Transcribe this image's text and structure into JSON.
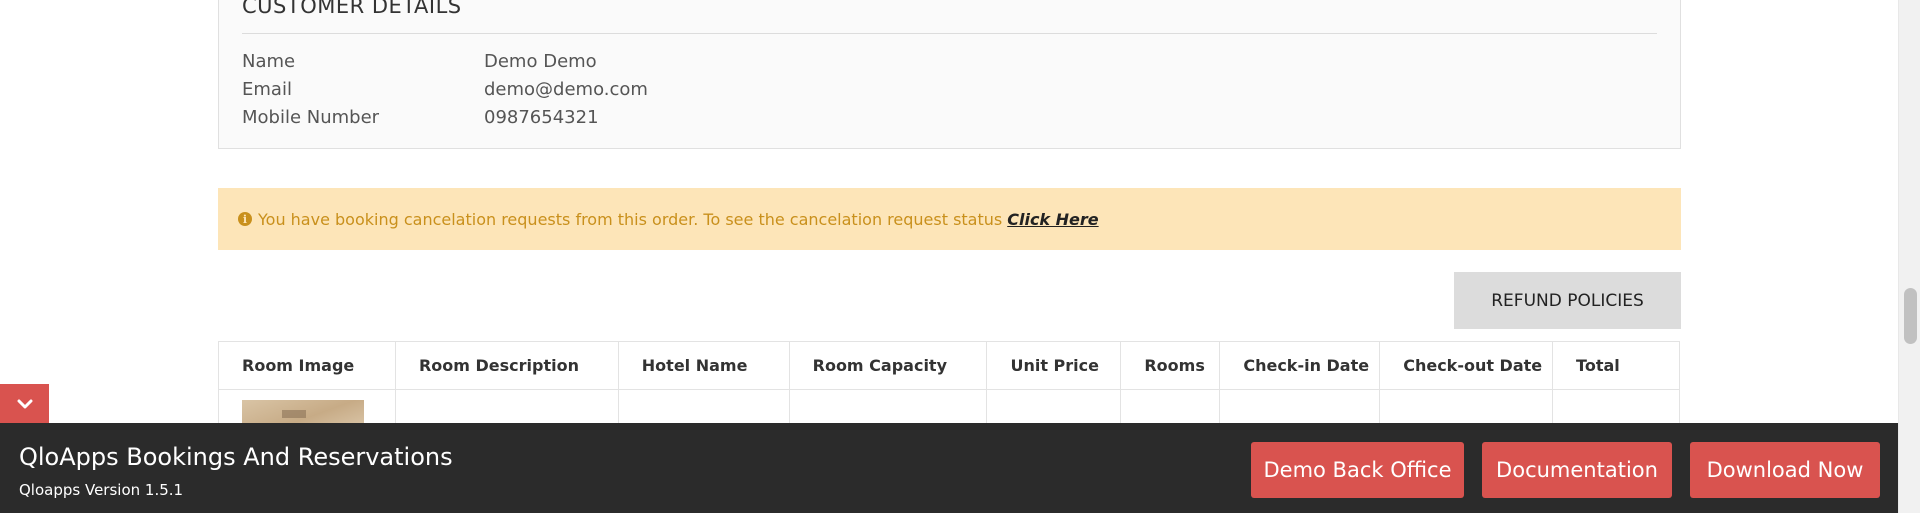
{
  "customer_details": {
    "title": "CUSTOMER DETAILS",
    "rows": [
      {
        "label": "Name",
        "value": "Demo Demo"
      },
      {
        "label": "Email",
        "value": "demo@demo.com"
      },
      {
        "label": "Mobile Number",
        "value": "0987654321"
      }
    ]
  },
  "alert": {
    "icon": "info-circle-icon",
    "message": "You have booking cancelation requests from this order. To see the cancelation request status",
    "link_text": "Click Here"
  },
  "refund_button": "REFUND POLICIES",
  "table": {
    "headers": [
      "Room Image",
      "Room Description",
      "Hotel Name",
      "Room Capacity",
      "Unit Price",
      "Rooms",
      "Check-in Date",
      "Check-out Date",
      "Total"
    ]
  },
  "bottom_bar": {
    "title": "QloApps Bookings And Reservations",
    "version": "Qloapps Version 1.5.1",
    "buttons": [
      "Demo Back Office",
      "Documentation",
      "Download Now"
    ],
    "accent_color": "#d9534f"
  },
  "collapse_toggle_icon": "chevron-down-icon"
}
